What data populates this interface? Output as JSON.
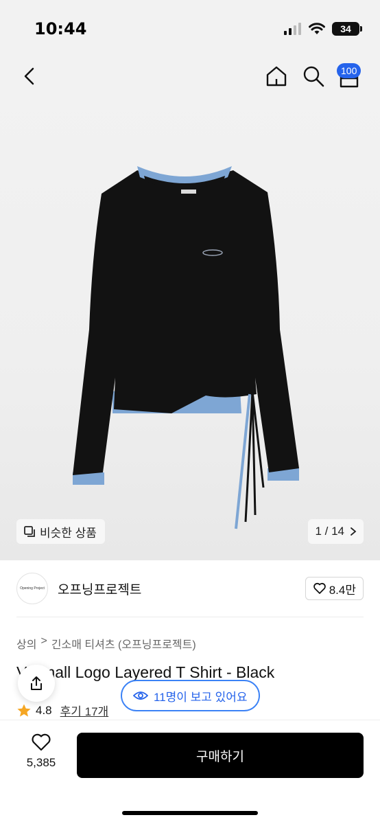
{
  "status_bar": {
    "time": "10:44",
    "battery": "34"
  },
  "nav": {
    "cart_count": "100"
  },
  "gallery": {
    "similar_label": "비슷한 상품",
    "counter": "1 / 14"
  },
  "brand": {
    "name": "오프닝프로젝트",
    "logo_text": "Opening Project",
    "likes": "8.4만"
  },
  "breadcrumb": [
    "상의",
    ">",
    "긴소매 티셔츠 (오프닝프로젝트)"
  ],
  "product": {
    "title": "V Small Logo Layered T Shirt - Black"
  },
  "rating": {
    "score": "4.8",
    "reviews": "후기 17개"
  },
  "viewers": "11명이 보고 있어요",
  "bottom": {
    "wish_count": "5,385",
    "buy_label": "구매하기"
  },
  "colors": {
    "accent": "#2563eb",
    "shirt": "#121212",
    "trim": "#7ea6d4",
    "star": "#f5a623"
  },
  "icons": [
    "back-icon",
    "home-icon",
    "search-icon",
    "cart-icon",
    "similar-icon",
    "chevron-right-icon",
    "heart-icon",
    "star-icon",
    "share-icon",
    "eye-icon"
  ]
}
